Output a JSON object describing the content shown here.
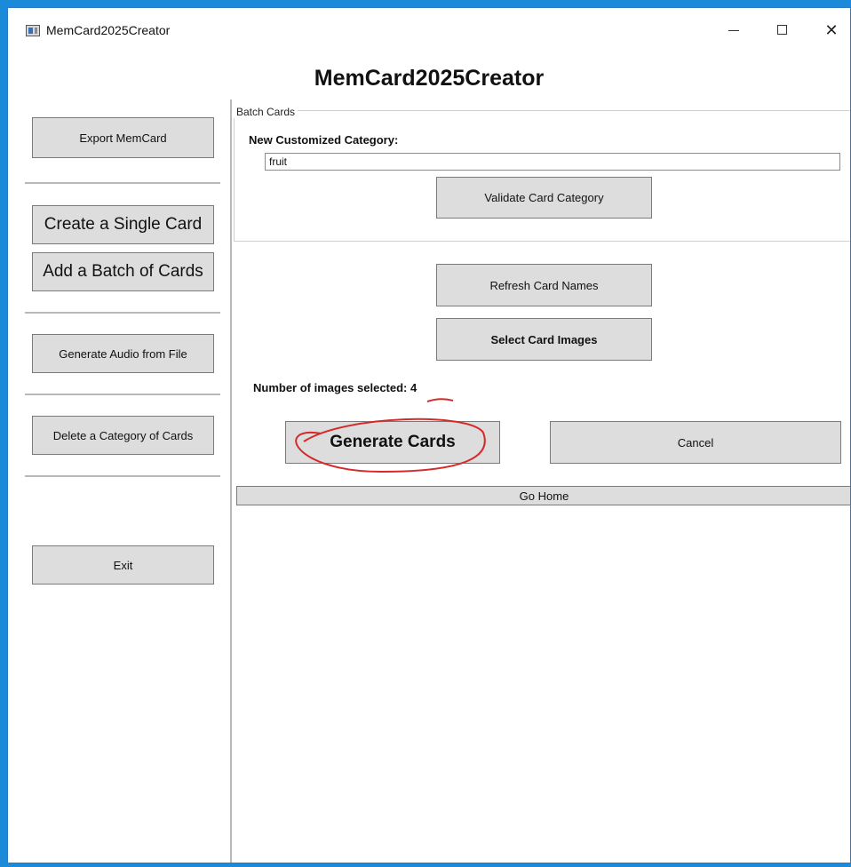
{
  "window": {
    "title": "MemCard2025Creator",
    "controls": {
      "minimize_icon": "minimize-icon",
      "maximize_icon": "maximize-icon",
      "close_glyph": "✕"
    }
  },
  "heading": "MemCard2025Creator",
  "sidebar": {
    "items": [
      {
        "label": "Export MemCard"
      },
      {
        "label": "Create a Single Card"
      },
      {
        "label": "Add a Batch of Cards"
      },
      {
        "label": "Generate Audio from File"
      },
      {
        "label": "Delete a Category of Cards"
      },
      {
        "label": "Exit"
      }
    ]
  },
  "batch": {
    "group_title": "Batch Cards",
    "category_label": "New Customized Category:",
    "category_value": "fruit",
    "validate_label": "Validate Card Category",
    "refresh_label": "Refresh Card Names",
    "select_images_label": "Select Card Images",
    "images_selected_label": "Number of images selected:",
    "images_selected_count": "4",
    "generate_label": "Generate Cards",
    "cancel_label": "Cancel",
    "go_home_label": "Go Home"
  },
  "colors": {
    "desktop": "#1b8ad8",
    "button_face": "#dddddd",
    "annotation": "#d42a2a"
  }
}
